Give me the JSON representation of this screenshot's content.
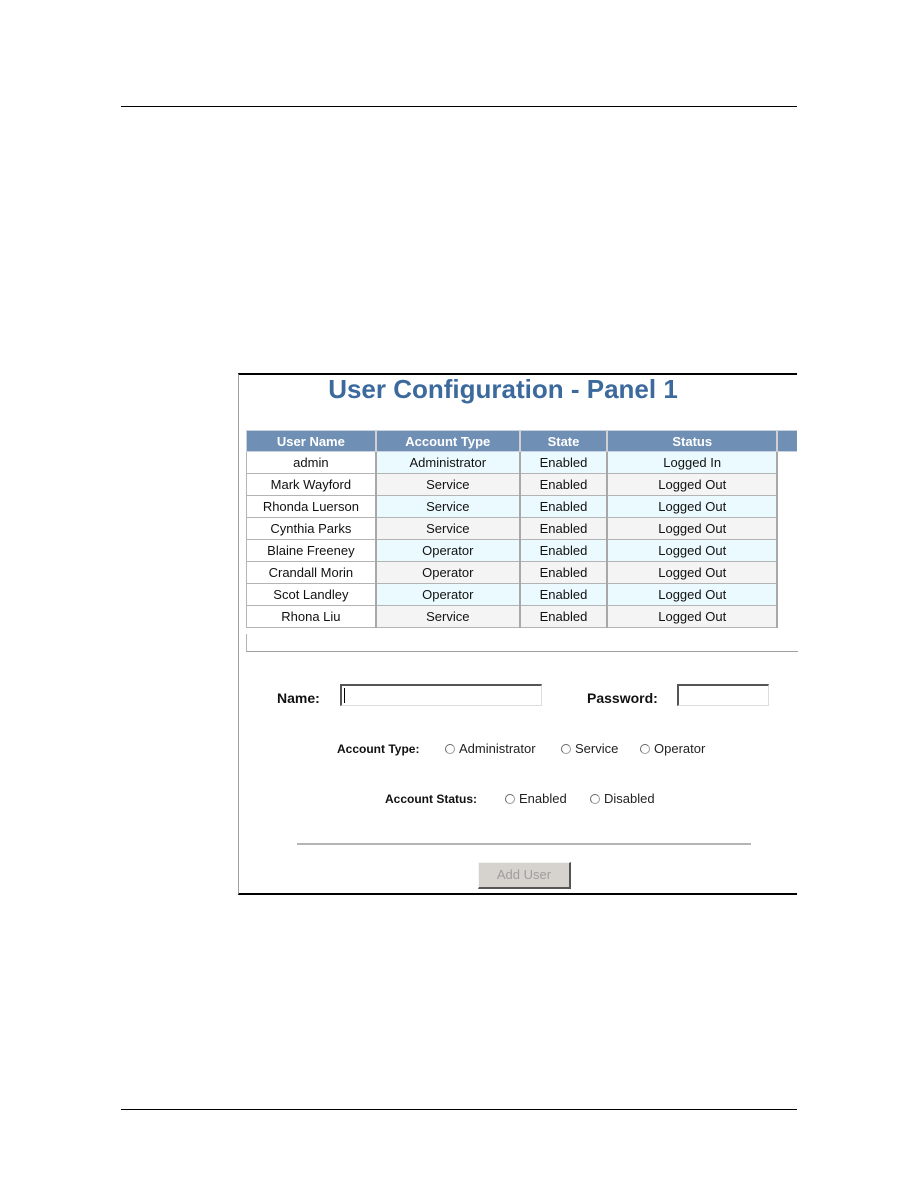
{
  "panel": {
    "title": "User Configuration - Panel 1"
  },
  "table": {
    "headers": [
      "User Name",
      "Account Type",
      "State",
      "Status"
    ],
    "rows": [
      {
        "user_name": "admin",
        "account_type": "Administrator",
        "state": "Enabled",
        "status": "Logged In"
      },
      {
        "user_name": "Mark Wayford",
        "account_type": "Service",
        "state": "Enabled",
        "status": "Logged Out"
      },
      {
        "user_name": "Rhonda Luerson",
        "account_type": "Service",
        "state": "Enabled",
        "status": "Logged Out"
      },
      {
        "user_name": "Cynthia Parks",
        "account_type": "Service",
        "state": "Enabled",
        "status": "Logged Out"
      },
      {
        "user_name": "Blaine Freeney",
        "account_type": "Operator",
        "state": "Enabled",
        "status": "Logged Out"
      },
      {
        "user_name": "Crandall Morin",
        "account_type": "Operator",
        "state": "Enabled",
        "status": "Logged Out"
      },
      {
        "user_name": "Scot Landley",
        "account_type": "Operator",
        "state": "Enabled",
        "status": "Logged Out"
      },
      {
        "user_name": "Rhona Liu",
        "account_type": "Service",
        "state": "Enabled",
        "status": "Logged Out"
      }
    ]
  },
  "form": {
    "name_label": "Name:",
    "name_value": "",
    "password_label": "Password:",
    "password_value": "",
    "account_type_label": "Account Type:",
    "account_type_options": [
      "Administrator",
      "Service",
      "Operator"
    ],
    "account_status_label": "Account Status:",
    "account_status_options": [
      "Enabled",
      "Disabled"
    ],
    "add_button_label": "Add User"
  },
  "colors": {
    "title": "#3c6a9c",
    "header_bg": "#6f8fb5",
    "row_odd": "#ebfaff",
    "row_even": "#f4f4f4"
  }
}
